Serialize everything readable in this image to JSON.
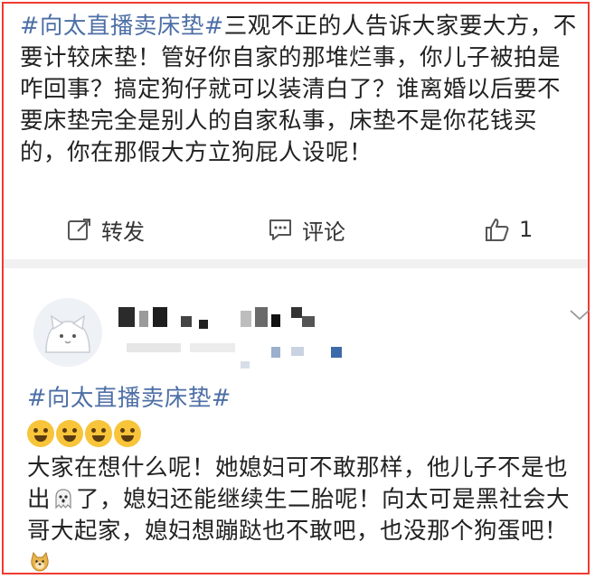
{
  "post": {
    "hashtag": "#向太直播卖床垫#",
    "text": "三观不正的人告诉大家要大方，不要计较床垫！管好你自家的那堆烂事，你儿子被拍是咋回事？搞定狗仔就可以装清白了？谁离婚以后要不要床垫完全是别人的自家私事，床垫不是你花钱买的，你在那假大方立狗屁人设呢！"
  },
  "actions": {
    "repost_label": "转发",
    "comment_label": "评论",
    "like_count": "1",
    "repost_icon": "share-icon",
    "comment_icon": "comment-icon",
    "like_icon": "thumbs-up-icon"
  },
  "reply": {
    "hashtag": "#向太直播卖床垫#",
    "emoji_name": "laugh-cry-emoji",
    "emoji_count": 4,
    "text_part1": "大家在想什么呢！她媳妇可不敢那样，他儿子不是也出",
    "inline_emoji_1": "ghost-emoji",
    "text_part2": "了，媳妇还能继续生二胎呢！向太可是黑社会大哥大起家，媳妇想蹦跶也不敢吧，也没那个狗蛋吧！",
    "inline_emoji_2": "doge-emoji"
  },
  "colors": {
    "border": "#ef3b32",
    "hashtag": "#4d6fa6",
    "text": "#222222"
  }
}
